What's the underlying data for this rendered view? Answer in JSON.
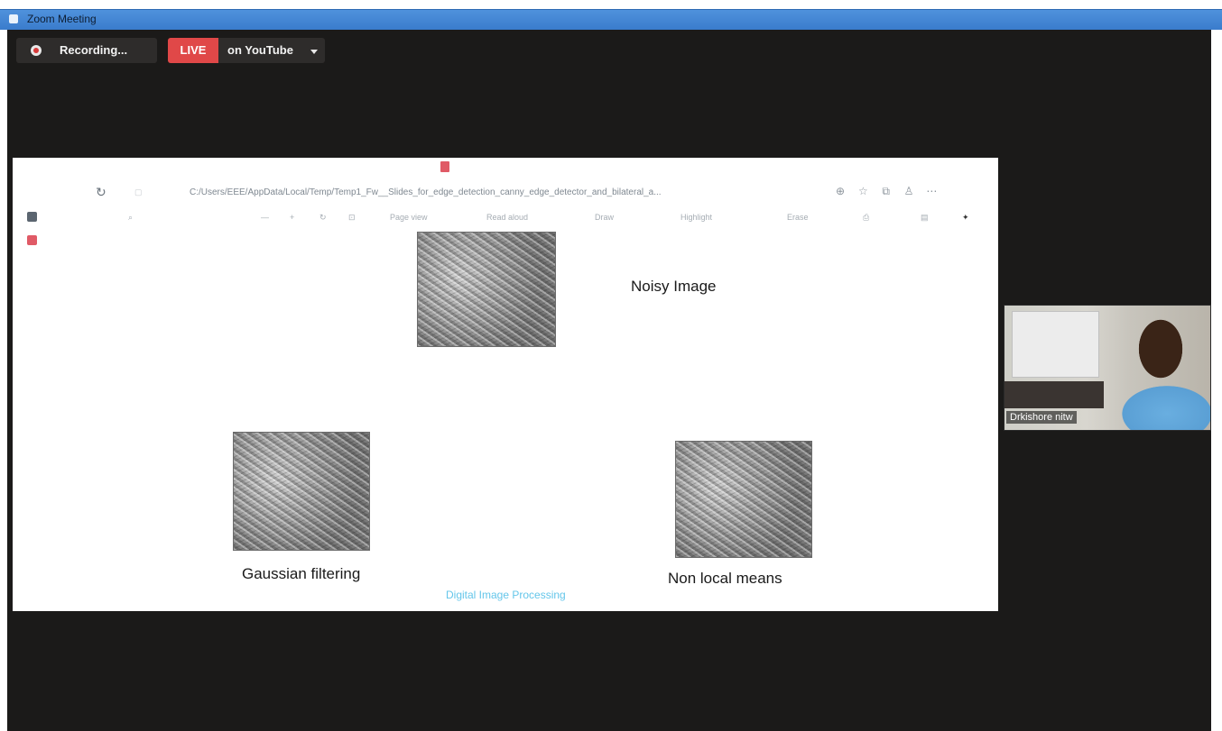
{
  "window": {
    "title": "Zoom Meeting"
  },
  "recording": {
    "label": "Recording..."
  },
  "live": {
    "badge": "LIVE",
    "destination": "on YouTube"
  },
  "shared_screen": {
    "url": "C:/Users/EEE/AppData/Local/Temp/Temp1_Fw__Slides_for_edge_detection_canny_edge_detector_and_bilateral_a...",
    "toolbar_items": [
      "Page view",
      "Read aloud",
      "Draw",
      "Highlight",
      "Erase"
    ],
    "slide": {
      "labels": {
        "noisy": "Noisy Image",
        "gaussian": "Gaussian filtering",
        "nonlocal": "Non local means"
      },
      "footer": "Digital Image Processing"
    }
  },
  "participant": {
    "name": "Drkishore nitw"
  }
}
